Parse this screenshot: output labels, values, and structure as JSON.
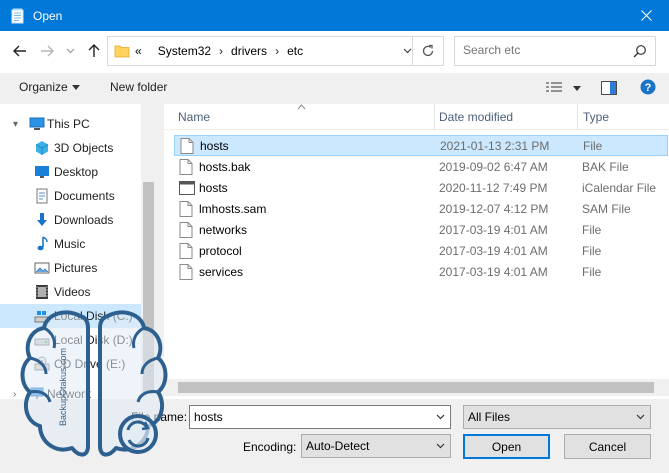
{
  "window": {
    "title": "Open"
  },
  "address": {
    "overflow": "«",
    "crumbs": [
      "System32",
      "drivers",
      "etc"
    ]
  },
  "search": {
    "placeholder": "Search etc"
  },
  "toolbar": {
    "organize_label": "Organize",
    "new_folder_label": "New folder"
  },
  "nav": {
    "items": [
      {
        "label": "This PC",
        "icon": "computer-icon"
      },
      {
        "label": "3D Objects",
        "icon": "3d-objects-icon"
      },
      {
        "label": "Desktop",
        "icon": "desktop-icon"
      },
      {
        "label": "Documents",
        "icon": "documents-icon"
      },
      {
        "label": "Downloads",
        "icon": "downloads-icon"
      },
      {
        "label": "Music",
        "icon": "music-icon"
      },
      {
        "label": "Pictures",
        "icon": "pictures-icon"
      },
      {
        "label": "Videos",
        "icon": "videos-icon"
      },
      {
        "label": "Local Disk (C:)",
        "icon": "drive-icon"
      },
      {
        "label": "Local Disk (D:)",
        "icon": "drive-icon"
      },
      {
        "label": "CD Drive (E:)",
        "icon": "cd-drive-icon"
      },
      {
        "label": "Network",
        "icon": "network-icon"
      }
    ]
  },
  "columns": {
    "name": "Name",
    "date": "Date modified",
    "type": "Type"
  },
  "files": [
    {
      "name": "hosts",
      "date": "2021-01-13 2:31 PM",
      "type": "File",
      "icon": "file-icon"
    },
    {
      "name": "hosts.bak",
      "date": "2019-09-02 6:47 AM",
      "type": "BAK File",
      "icon": "file-icon"
    },
    {
      "name": "hosts",
      "date": "2020-11-12 7:49 PM",
      "type": "iCalendar File",
      "icon": "calendar-icon"
    },
    {
      "name": "lmhosts.sam",
      "date": "2019-12-07 4:12 PM",
      "type": "SAM File",
      "icon": "file-icon"
    },
    {
      "name": "networks",
      "date": "2017-03-19 4:01 AM",
      "type": "File",
      "icon": "file-icon"
    },
    {
      "name": "protocol",
      "date": "2017-03-19 4:01 AM",
      "type": "File",
      "icon": "file-icon"
    },
    {
      "name": "services",
      "date": "2017-03-19 4:01 AM",
      "type": "File",
      "icon": "file-icon"
    }
  ],
  "bottom": {
    "filename_label": "File name:",
    "filename_value": "hosts",
    "filter_value": "All Files",
    "encoding_label": "Encoding:",
    "encoding_value": "Auto-Detect",
    "open_label": "Open",
    "cancel_label": "Cancel"
  },
  "watermark": {
    "text": "BackupOtakus.com"
  },
  "colors": {
    "accent": "#0078d7",
    "selection": "#cce8ff"
  }
}
